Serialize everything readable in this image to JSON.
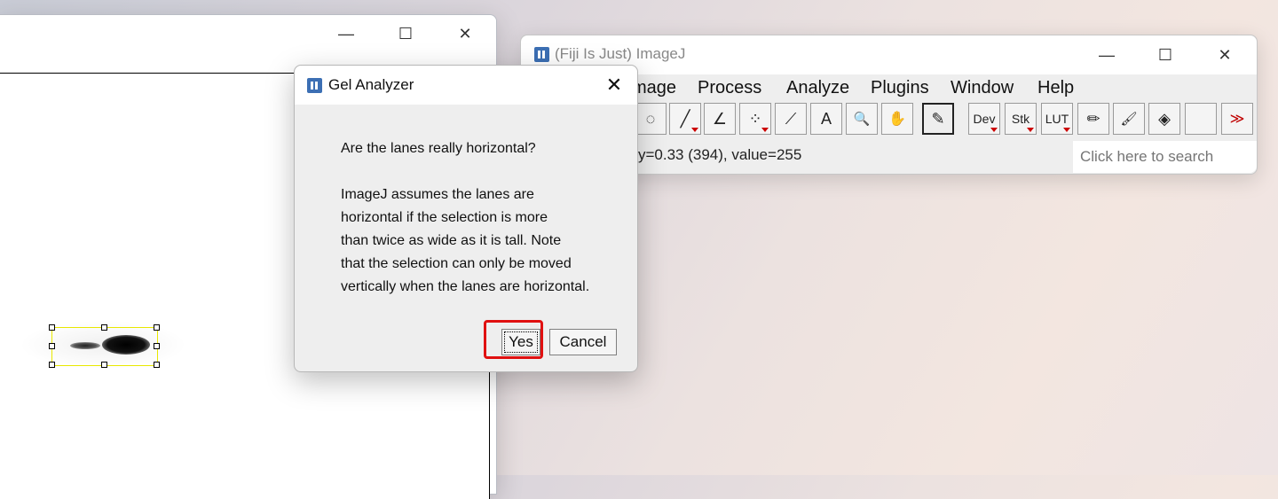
{
  "image_window": {
    "controls": {
      "minimize": "—",
      "maximize": "☐",
      "close": "✕"
    }
  },
  "imagej_window": {
    "title": "(Fiji Is Just) ImageJ",
    "controls": {
      "minimize": "—",
      "maximize": "☐",
      "close": "✕"
    },
    "menu": [
      "Image",
      "Process",
      "Analyze",
      "Plugins",
      "Window",
      "Help"
    ],
    "menu_visible_first": "mage",
    "tools": [
      {
        "name": "freehand-selection-icon",
        "glyph": "◌"
      },
      {
        "name": "line-tool-icon",
        "glyph": "╱"
      },
      {
        "name": "angle-tool-icon",
        "glyph": "∠"
      },
      {
        "name": "multipoint-tool-icon",
        "glyph": "⁘"
      },
      {
        "name": "wand-tool-icon",
        "glyph": "⟋"
      },
      {
        "name": "text-tool-icon",
        "glyph": "A"
      },
      {
        "name": "magnifier-icon",
        "glyph": "🔍"
      },
      {
        "name": "hand-tool-icon",
        "glyph": "✋"
      },
      {
        "name": "color-picker-icon",
        "glyph": "✎"
      },
      {
        "name": "dev-menu",
        "glyph": "Dev"
      },
      {
        "name": "stk-menu",
        "glyph": "Stk"
      },
      {
        "name": "lut-menu",
        "glyph": "LUT"
      },
      {
        "name": "pencil-icon",
        "glyph": "✏"
      },
      {
        "name": "brush-icon",
        "glyph": "🖌"
      },
      {
        "name": "flood-fill-icon",
        "glyph": "◈"
      },
      {
        "name": "blank-tool",
        "glyph": ""
      },
      {
        "name": "more-tools-icon",
        "glyph": "≫"
      }
    ],
    "status_text": "y=0.33 (394), value=255",
    "search_placeholder": "Click here to search"
  },
  "dialog": {
    "title": "Gel Analyzer",
    "close": "✕",
    "question": "Are the lanes really horizontal?",
    "body_lines": [
      "ImageJ assumes the lanes are",
      "horizontal if the selection is more",
      "than twice as wide as it is tall. Note",
      "that the selection can only be moved",
      "vertically when the lanes are horizontal."
    ],
    "yes_label": "Yes",
    "cancel_label": "Cancel"
  },
  "colors": {
    "selection": "#e8e800",
    "highlight": "#e01010",
    "app_icon": "#3c6fb4",
    "more_tools": "#c00000"
  }
}
